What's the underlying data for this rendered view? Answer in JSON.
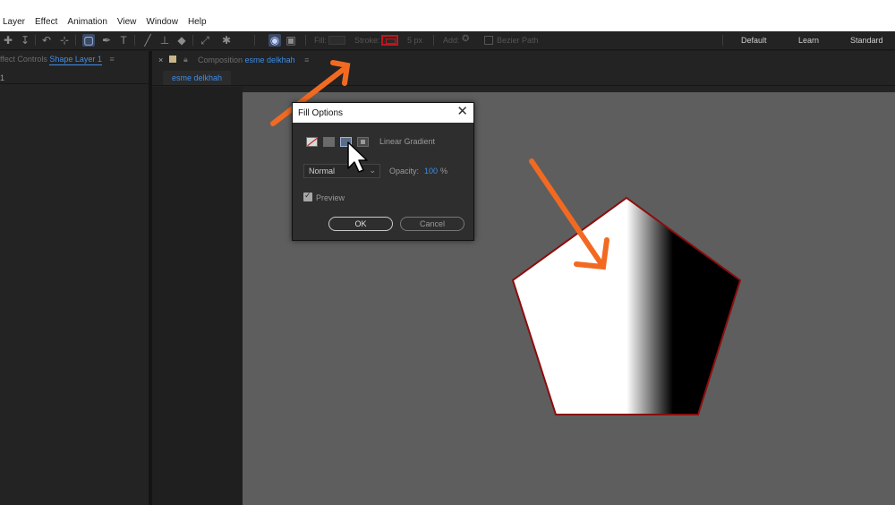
{
  "menu": {
    "items": [
      "Layer",
      "Effect",
      "Animation",
      "View",
      "Window",
      "Help"
    ]
  },
  "toolbar": {
    "fill_label": "Fill:",
    "stroke_label": "Stroke:",
    "stroke_width": "5 px",
    "add_label": "Add:",
    "bezier_label": "Bezier Path",
    "workspaces": [
      "Default",
      "Learn",
      "Standard"
    ],
    "stroke_color": "#c2141c"
  },
  "left_panel": {
    "tab_prefix": "ffect Controls",
    "tab_active": "Shape Layer 1",
    "tab_menu": "≡",
    "first_row": "1"
  },
  "composition": {
    "tab_prefix": "Composition",
    "tab_name": "esme delkhah",
    "tab_menu": "≡",
    "subtab": "esme delkhah"
  },
  "dialog": {
    "title": "Fill Options",
    "close": "✕",
    "fill_type": "Linear Gradient",
    "blend_mode": "Normal",
    "opacity_label": "Opacity:",
    "opacity_value": "100",
    "opacity_unit": "%",
    "preview_label": "Preview",
    "preview_checked": true,
    "ok_label": "OK",
    "cancel_label": "Cancel"
  },
  "colors": {
    "accent": "#3d8ee8",
    "arrow": "#f26a21",
    "shape_outline": "#8b0d0d",
    "viewer_bg": "#5e5e5e"
  },
  "icons": [
    "add-anchor-icon",
    "down-arrow-icon",
    "rotate-icon",
    "pan-behind-icon",
    "shape-tool-icon",
    "pen-tool-icon",
    "text-tool-icon",
    "brush-icon",
    "clone-stamp-icon",
    "eraser-icon",
    "roto-brush-icon",
    "puppet-pin-icon",
    "snap-icon"
  ]
}
